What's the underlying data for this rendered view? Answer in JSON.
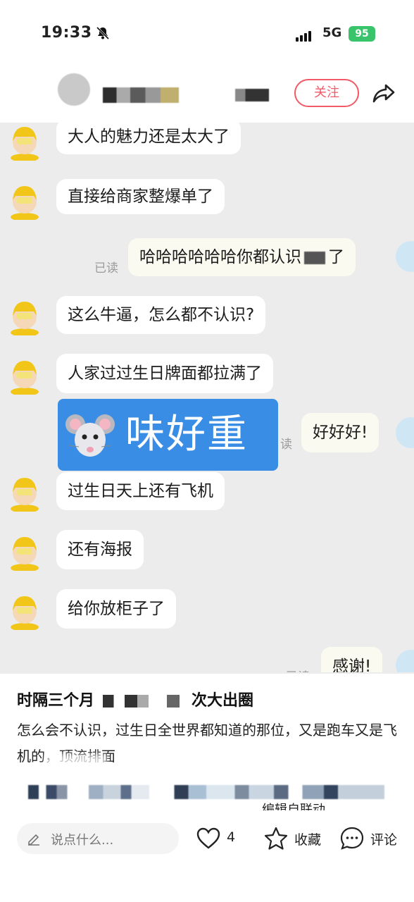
{
  "status_bar": {
    "time": "19:33",
    "network": "5G",
    "battery": "95"
  },
  "header": {
    "follow_label": "关注"
  },
  "chat": {
    "messages": [
      {
        "side": "left",
        "text": "大人的魅力还是太大了"
      },
      {
        "side": "left",
        "text": "直接给商家整爆单了"
      },
      {
        "side": "right",
        "text": "哈哈哈哈哈哈你都认识",
        "text_tail": "了",
        "read": "已读"
      },
      {
        "side": "left",
        "text": "这么牛逼，怎么都不认识?"
      },
      {
        "side": "left",
        "text": "人家过过生日牌面都拉满了"
      },
      {
        "side": "right",
        "text": "好好好!",
        "read": "读"
      },
      {
        "side": "left",
        "text": "过生日天上还有飞机"
      },
      {
        "side": "left",
        "text": "还有海报"
      },
      {
        "side": "left",
        "text": "给你放柜子了"
      },
      {
        "side": "right",
        "text": "感谢!",
        "read": "已读"
      }
    ]
  },
  "overlay": {
    "text": "味好重",
    "icon": "mouse-face-icon"
  },
  "post": {
    "title_start": "时隔三个月",
    "title_end": "次大出圈",
    "body": "怎么会不认识，过生日全世界都知道的那位，又是跑车又是飞机的，顶流排面",
    "partial_line": "编辑自联动"
  },
  "actions": {
    "comment_placeholder": "说点什么...",
    "like_count": "4",
    "collect_label": "收藏",
    "comment_label": "评论"
  },
  "colors": {
    "accent": "#f15a66",
    "overlay": "#3a8de5",
    "battery": "#39c46b"
  }
}
